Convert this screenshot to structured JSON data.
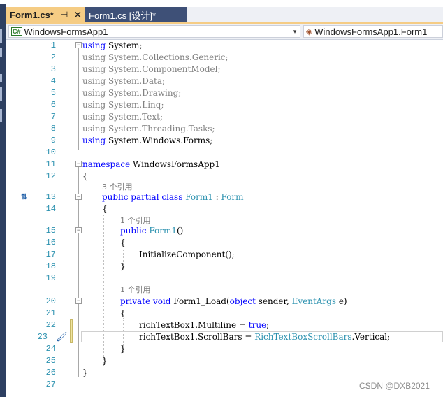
{
  "tabs": {
    "active_label": "Form1.cs*",
    "pin_glyph": "⊣",
    "close_glyph": "✕",
    "inactive_label": "Form1.cs [设计]*"
  },
  "nav": {
    "project": "WindowsFormsApp1",
    "project_icon": "C#",
    "member": "WindowsFormsApp1.Form1",
    "dropdown_glyph": "▾"
  },
  "editor": {
    "line_numbers": [
      "1",
      "2",
      "3",
      "4",
      "5",
      "6",
      "7",
      "8",
      "9",
      "10",
      "11",
      "12",
      "13",
      "14",
      "15",
      "16",
      "17",
      "18",
      "19",
      "20",
      "21",
      "22",
      "23",
      "24",
      "25",
      "26",
      "27"
    ],
    "ref_hint": "个引用",
    "ref_counts": {
      "class": "3",
      "ctor": "1",
      "load": "1"
    },
    "usings": [
      "System",
      "System.Collections.Generic",
      "System.ComponentModel",
      "System.Data",
      "System.Drawing",
      "System.Linq",
      "System.Text",
      "System.Threading.Tasks",
      "System.Windows.Forms"
    ],
    "namespace_name": "WindowsFormsApp1",
    "class_name": "Form1",
    "base_class": "Form",
    "ctor_name": "Form1",
    "init_call": "InitializeComponent();",
    "method_name": "Form1_Load",
    "param_type": "EventArgs",
    "line22_target": "richTextBox1.Multiline",
    "line23_target": "richTextBox1.ScrollBars",
    "enum_type": "RichTextBoxScrollBars",
    "enum_value": ".Vertical;",
    "bool_value": "true"
  },
  "watermark": "CSDN @DXB2021",
  "colors": {
    "keyword": "#0000ff",
    "type": "#2b91af",
    "line_number": "#2b91af",
    "active_tab": "#f5cc84",
    "inactive_tab": "#3e5077"
  }
}
